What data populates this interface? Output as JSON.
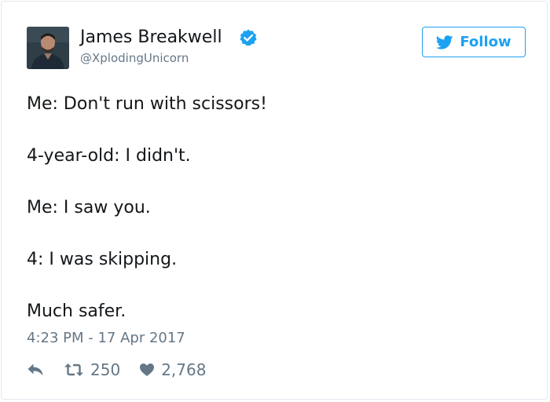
{
  "tweet": {
    "author": {
      "name": "James Breakwell",
      "handle": "@XplodingUnicorn",
      "verified": true
    },
    "follow_label": "Follow",
    "lines": [
      "Me: Don't run with scissors!",
      "4-year-old: I didn't.",
      "Me: I saw you.",
      "4: I was skipping.",
      "Much safer."
    ],
    "timestamp": "4:23 PM - 17 Apr 2017",
    "retweets": "250",
    "likes": "2,768"
  },
  "icons": {
    "verified": "verified-badge-icon",
    "follow": "twitter-bird-icon",
    "reply": "reply-icon",
    "retweet": "retweet-icon",
    "like": "heart-icon"
  },
  "colors": {
    "accent": "#1da1f2",
    "text": "#14171a",
    "muted": "#657786",
    "border": "#e1e8ed"
  }
}
